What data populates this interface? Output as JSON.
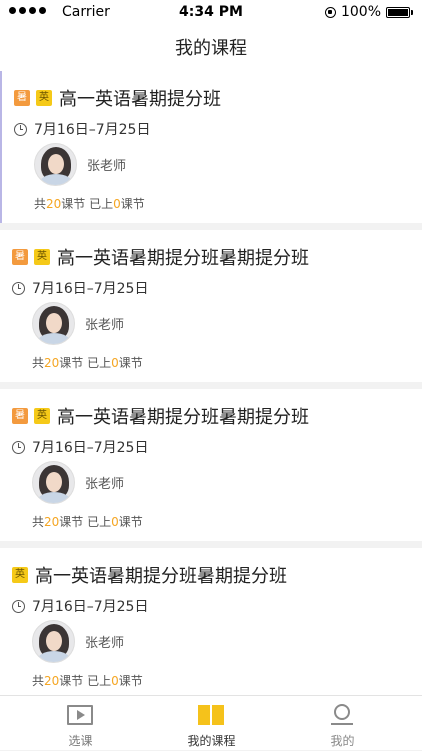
{
  "status_bar": {
    "carrier": "Carrier",
    "time": "4:34 PM",
    "battery": "100%"
  },
  "nav": {
    "title": "我的课程"
  },
  "courses": [
    {
      "tags": [
        "暑",
        "英"
      ],
      "title": "高一英语暑期提分班",
      "date": "7月16日–7月25日",
      "teacher": "张老师",
      "lesson_prefix": "共",
      "total": "20",
      "mid": "课节 已上",
      "done": "0",
      "suffix": "课节"
    },
    {
      "tags": [
        "暑",
        "英"
      ],
      "title": "高一英语暑期提分班暑期提分班",
      "date": "7月16日–7月25日",
      "teacher": "张老师",
      "lesson_prefix": "共",
      "total": "20",
      "mid": "课节 已上",
      "done": "0",
      "suffix": "课节"
    },
    {
      "tags": [
        "暑",
        "英"
      ],
      "title": "高一英语暑期提分班暑期提分班",
      "date": "7月16日–7月25日",
      "teacher": "张老师",
      "lesson_prefix": "共",
      "total": "20",
      "mid": "课节 已上",
      "done": "0",
      "suffix": "课节"
    },
    {
      "tags": [
        "英"
      ],
      "title": "高一英语暑期提分班暑期提分班",
      "date": "7月16日–7月25日",
      "teacher": "张老师",
      "lesson_prefix": "共",
      "total": "20",
      "mid": "课节 已上",
      "done": "0",
      "suffix": "课节"
    }
  ],
  "tabs": [
    {
      "label": "选课",
      "icon": "video-icon",
      "active": false
    },
    {
      "label": "我的课程",
      "icon": "book-icon",
      "active": true
    },
    {
      "label": "我的",
      "icon": "person-icon",
      "active": false
    }
  ],
  "colors": {
    "accent": "#f5c21b",
    "highlight": "#f5a623",
    "summer_tag": "#f39a3e",
    "english_tag": "#f5c918"
  }
}
